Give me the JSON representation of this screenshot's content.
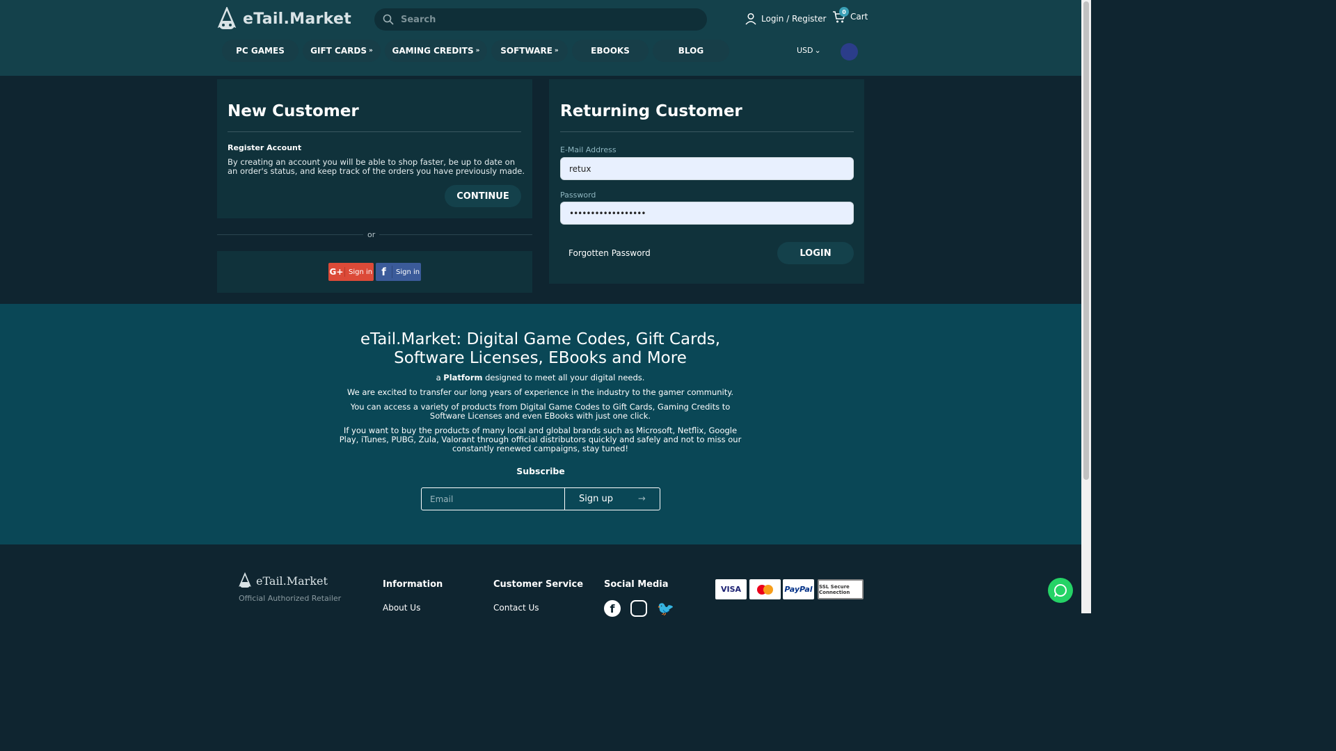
{
  "header": {
    "logo_text": "eTail.Market",
    "search_placeholder": "Search",
    "account_label": "Login / Register",
    "cart_label": "Cart",
    "cart_count": "0",
    "currency": "USD"
  },
  "nav": [
    {
      "label": "PC GAMES",
      "dropdown": false
    },
    {
      "label": "GIFT CARDS",
      "dropdown": true
    },
    {
      "label": "GAMING CREDITS",
      "dropdown": true
    },
    {
      "label": "SOFTWARE",
      "dropdown": true
    },
    {
      "label": "EBOOKS",
      "dropdown": false
    },
    {
      "label": "BLOG",
      "dropdown": false
    }
  ],
  "new_customer": {
    "title": "New Customer",
    "subtitle": "Register Account",
    "text": "By creating an account you will be able to shop faster, be up to date on an order's status, and keep track of the orders you have previously made.",
    "continue_label": "CONTINUE",
    "or_label": "or",
    "google_label": "Sign in",
    "facebook_label": "Sign in"
  },
  "returning_customer": {
    "title": "Returning Customer",
    "email_label": "E-Mail Address",
    "email_value": "retux",
    "password_label": "Password",
    "password_value": "••••••••••••••••••",
    "forgot_label": "Forgotten Password",
    "login_label": "LOGIN"
  },
  "about": {
    "title": "eTail.Market: Digital Game Codes, Gift Cards, Software Licenses, EBooks and More",
    "line1_pre": "a ",
    "line1_bold": "Platform",
    "line1_post": " designed to meet all your digital needs.",
    "line2": "We are excited to transfer our long years of experience in the industry to the gamer community.",
    "line3": "You can access a variety of products from Digital Game Codes to Gift Cards, Gaming Credits to Software Licenses and even EBooks with just one click.",
    "line4": "If you want to buy the products of many local and global brands such as Microsoft, Netflix, Google Play, iTunes, PUBG, Zula, Valorant through official distributors quickly and safely and not to miss our constantly renewed campaigns, stay tuned!",
    "subscribe_title": "Subscribe",
    "email_placeholder": "Email",
    "signup_label": "Sign up"
  },
  "footer": {
    "logo_text": "eTail.Market",
    "tagline": "Official Authorized Retailer",
    "col_info": "Information",
    "col_info_link": "About Us",
    "col_service": "Customer Service",
    "col_service_link": "Contact Us",
    "col_social": "Social Media",
    "payments": [
      "VISA",
      "mastercard",
      "PayPal",
      "SSL Secure Connection"
    ]
  }
}
